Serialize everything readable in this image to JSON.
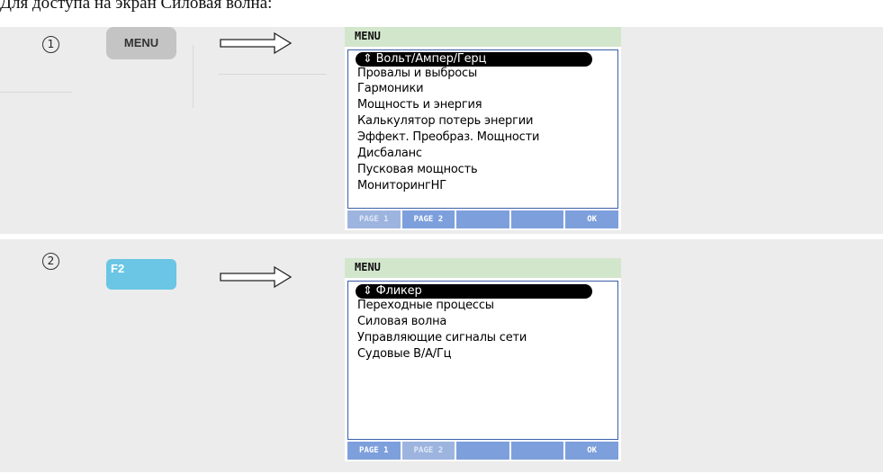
{
  "intro_text": "Для доступа на экран Силовая волна:",
  "steps": [
    {
      "number": "1",
      "key_label": "MENU",
      "screen": {
        "title": "MENU",
        "selected_arrow": "⇕",
        "items": [
          "Вольт/Ампер/Герц",
          "Провалы и выбросы",
          "Гармоники",
          "Мощность и энергия",
          "Калькулятор потерь энергии",
          "Эффект. Преобраз. Мощности",
          "Дисбаланс",
          "Пусковая мощность",
          "МониторингНГ"
        ],
        "softkeys": [
          "PAGE 1",
          "PAGE 2",
          "",
          "",
          "OK"
        ]
      }
    },
    {
      "number": "2",
      "key_label": "F2",
      "screen": {
        "title": "MENU",
        "selected_arrow": "⇕",
        "items": [
          "Фликер",
          "Переходные процессы",
          "Силовая волна",
          "Управляющие сигналы сети",
          "Судовые В/А/Гц"
        ],
        "softkeys": [
          "PAGE 1",
          "PAGE 2",
          "",
          "",
          "OK"
        ]
      }
    }
  ]
}
